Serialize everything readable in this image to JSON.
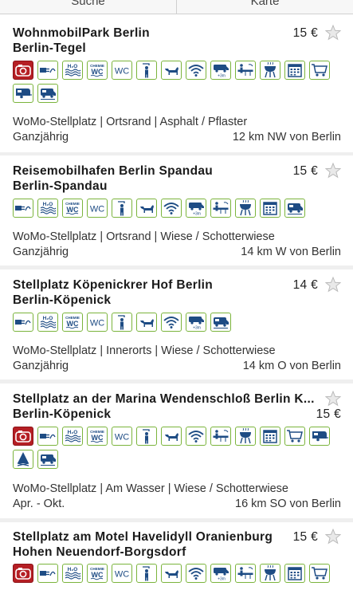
{
  "tabs": {
    "search": "Suche",
    "map": "Karte"
  },
  "colors": {
    "icon_border": "#7bb43c",
    "icon_fill": "#1e4c84",
    "red_icon": "#b51f24"
  },
  "listings": [
    {
      "name": "WohnmobilPark Berlin",
      "location": "Berlin-Tegel",
      "price": "15 €",
      "amenities": [
        "camera-icon",
        "electricity-icon",
        "water-icon",
        "chem-wc-icon",
        "wc-icon",
        "shower-icon",
        "dog-icon",
        "wifi-icon",
        "van-icon",
        "bbq-area-icon",
        "grill-icon",
        "calendar-icon",
        "cart-icon",
        "caravan-icon",
        "motorhome-icon"
      ],
      "details": "WoMo-Stellplatz | Ortsrand | Asphalt / Pflaster",
      "season": "Ganzjährig",
      "distance": "12 km NW von Berlin"
    },
    {
      "name": "Reisemobilhafen Berlin Spandau",
      "location": "Berlin-Spandau",
      "price": "15 €",
      "amenities": [
        "electricity-icon",
        "water-icon",
        "chem-wc-icon",
        "wc-icon",
        "shower-icon",
        "dog-icon",
        "wifi-icon",
        "van-icon",
        "bbq-area-icon",
        "grill-icon",
        "calendar-icon",
        "motorhome-icon"
      ],
      "details": "WoMo-Stellplatz | Ortsrand | Wiese / Schotterwiese",
      "season": "Ganzjährig",
      "distance": "14 km W von Berlin"
    },
    {
      "name": "Stellplatz Köpenickrer Hof Berlin",
      "location": "Berlin-Köpenick",
      "price": "14 €",
      "amenities": [
        "electricity-icon",
        "water-icon",
        "chem-wc-icon",
        "wc-icon",
        "shower-icon",
        "dog-icon",
        "wifi-icon",
        "van-icon",
        "motorhome-icon"
      ],
      "details": "WoMo-Stellplatz | Innerorts | Wiese / Schotterwiese",
      "season": "Ganzjährig",
      "distance": "14 km O von Berlin"
    },
    {
      "name": "Stellplatz an der Marina Wendenschloß Berlin K...",
      "location": "Berlin-Köpenick",
      "price": "15 €",
      "amenities": [
        "camera-icon",
        "electricity-icon",
        "water-icon",
        "chem-wc-icon",
        "wc-icon",
        "shower-icon",
        "dog-icon",
        "wifi-icon",
        "bbq-area-icon",
        "grill-icon",
        "calendar-icon",
        "cart-icon",
        "caravan-icon",
        "campfire-icon",
        "motorhome-icon"
      ],
      "details": "WoMo-Stellplatz | Am Wasser | Wiese / Schotterwiese",
      "season": "Apr. - Okt.",
      "distance": "16 km SO von Berlin"
    },
    {
      "name": "Stellplatz am Motel Havelidyll Oranienburg",
      "location": "Hohen Neuendorf-Borgsdorf",
      "price": "15 €",
      "amenities": [
        "camera-icon",
        "electricity-icon",
        "water-icon",
        "chem-wc-icon",
        "wc-icon",
        "shower-icon",
        "dog-icon",
        "wifi-icon",
        "van-icon",
        "bbq-area-icon",
        "grill-icon",
        "calendar-icon",
        "cart-icon"
      ],
      "details": "",
      "season": "",
      "distance": ""
    }
  ],
  "icon_labels": {
    "water": "H₂O",
    "chem_top": "CHEMIE",
    "chem_bottom": "WC",
    "wc": "WC",
    "dist": "+3m"
  }
}
